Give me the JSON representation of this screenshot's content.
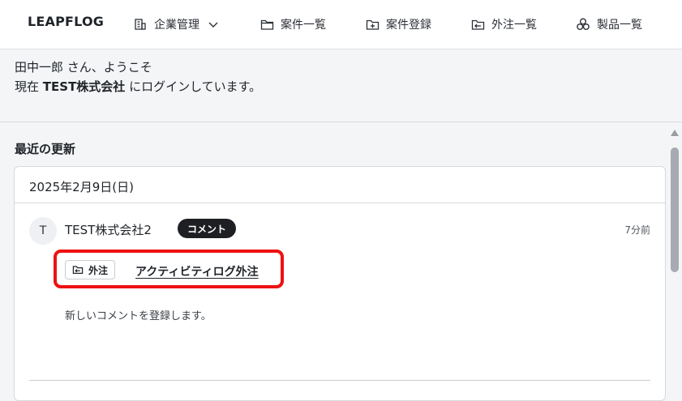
{
  "header": {
    "logo": "LEAPFLOG",
    "nav": [
      {
        "label": "企業管理",
        "icon": "building-icon",
        "has_dropdown": true
      },
      {
        "label": "案件一覧",
        "icon": "folder-icon"
      },
      {
        "label": "案件登録",
        "icon": "folder-plus-icon"
      },
      {
        "label": "外注一覧",
        "icon": "outsource-icon"
      },
      {
        "label": "製品一覧",
        "icon": "products-icon"
      }
    ]
  },
  "welcome": {
    "greeting": "田中一郎 さん、ようこそ",
    "login_prefix": "現在 ",
    "company": "TEST株式会社",
    "login_suffix": " にログインしています。"
  },
  "updates": {
    "title": "最近の更新",
    "date": "2025年2月9日(日)",
    "items": [
      {
        "avatar_initial": "T",
        "company": "TEST株式会社2",
        "badge": "コメント",
        "time": "7分前",
        "tag_label": "外注",
        "tag_icon": "outsource-icon",
        "link_text": "アクティビティログ外注",
        "comment": "新しいコメントを登録します。"
      }
    ]
  },
  "colors": {
    "highlight": "#ee1111",
    "badge_bg": "#1e1f22",
    "background": "#f4f5f7"
  }
}
